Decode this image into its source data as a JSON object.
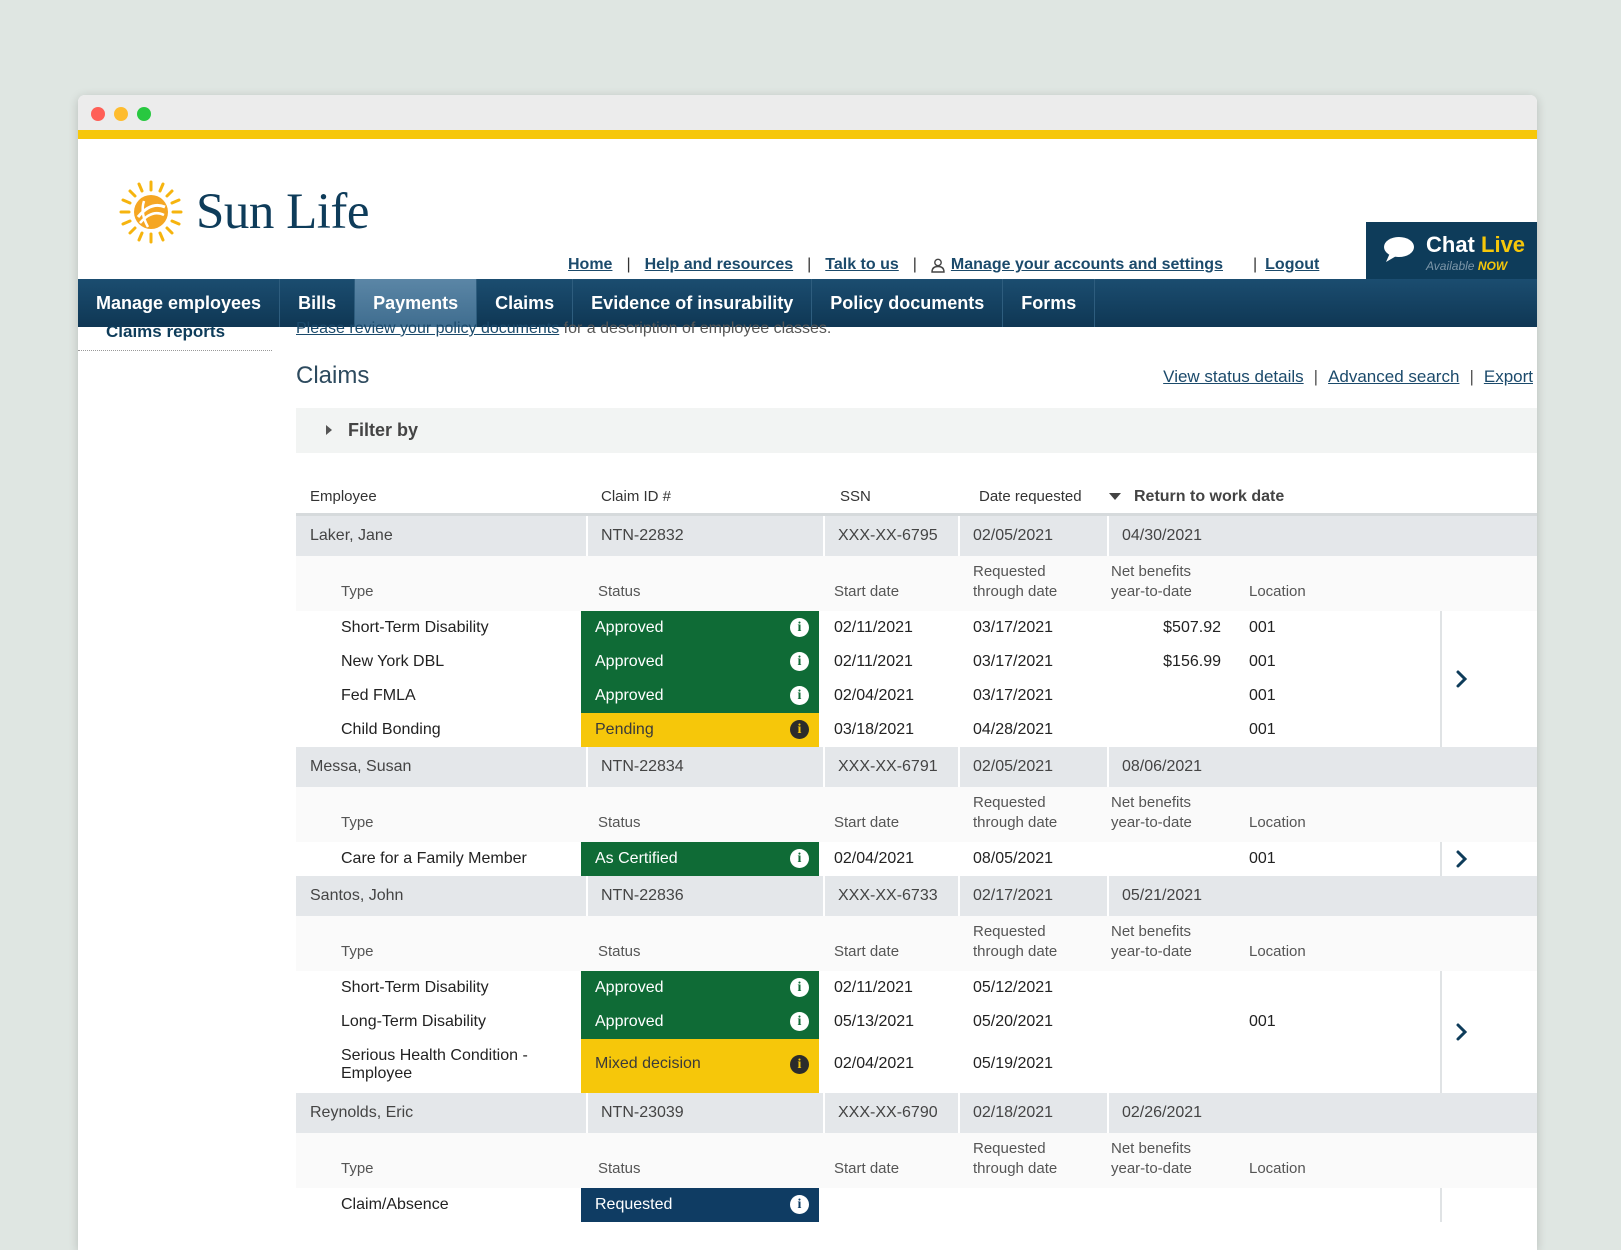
{
  "brand": {
    "name": "Sun Life"
  },
  "toplinks": {
    "home": "Home",
    "help": "Help and resources",
    "talk": "Talk to us",
    "manage": "Manage your accounts and settings",
    "logout": "Logout",
    "sep": "|"
  },
  "chat": {
    "title_a": "Chat",
    "title_b": "Live",
    "sub_a": "Available",
    "sub_b": "NOW"
  },
  "nav": {
    "items": [
      "Manage employees",
      "Bills",
      "Payments",
      "Claims",
      "Evidence of insurability",
      "Policy documents",
      "Forms"
    ],
    "active": "Payments"
  },
  "sidebar": {
    "item": "Claims reports"
  },
  "notice": {
    "link": "Please review your policy documents",
    "rest": " for a description of employee classes."
  },
  "page": {
    "title": "Claims"
  },
  "actions": {
    "status": "View status details",
    "search": "Advanced search",
    "export": "Export",
    "sep": "|"
  },
  "filter": {
    "label": "Filter by"
  },
  "columns": {
    "employee": "Employee",
    "claim": "Claim ID #",
    "ssn": "SSN",
    "date": "Date requested",
    "return": "Return to work date"
  },
  "sub_columns": {
    "type": "Type",
    "status": "Status",
    "start": "Start date",
    "through_a": "Requested",
    "through_b": "through date",
    "net_a": "Net benefits",
    "net_b": "year-to-date",
    "location": "Location"
  },
  "colors": {
    "approved": "#0f6b36",
    "pending": "#f6c70a",
    "requested": "#0f3c63",
    "nav": "#0f3754",
    "accent": "#f6c70a"
  },
  "claims": [
    {
      "employee": "Laker, Jane",
      "claim_id": "NTN-22832",
      "ssn": "XXX-XX-6795",
      "date_requested": "02/05/2021",
      "return_date": "04/30/2021",
      "lines": [
        {
          "type": "Short-Term Disability",
          "status": "Approved",
          "start": "02/11/2021",
          "through": "03/17/2021",
          "net": "$507.92",
          "location": "001"
        },
        {
          "type": "New York DBL",
          "status": "Approved",
          "start": "02/11/2021",
          "through": "03/17/2021",
          "net": "$156.99",
          "location": "001"
        },
        {
          "type": "Fed FMLA",
          "status": "Approved",
          "start": "02/04/2021",
          "through": "03/17/2021",
          "net": "",
          "location": "001"
        },
        {
          "type": "Child Bonding",
          "status": "Pending",
          "start": "03/18/2021",
          "through": "04/28/2021",
          "net": "",
          "location": "001"
        }
      ]
    },
    {
      "employee": "Messa, Susan",
      "claim_id": "NTN-22834",
      "ssn": "XXX-XX-6791",
      "date_requested": "02/05/2021",
      "return_date": "08/06/2021",
      "lines": [
        {
          "type": "Care for a Family Member",
          "status": "As Certified",
          "start": "02/04/2021",
          "through": "08/05/2021",
          "net": "",
          "location": "001"
        }
      ]
    },
    {
      "employee": "Santos, John",
      "claim_id": "NTN-22836",
      "ssn": "XXX-XX-6733",
      "date_requested": "02/17/2021",
      "return_date": "05/21/2021",
      "lines": [
        {
          "type": "Short-Term Disability",
          "status": "Approved",
          "start": "02/11/2021",
          "through": "05/12/2021",
          "net": "",
          "location": ""
        },
        {
          "type": "Long-Term Disability",
          "status": "Approved",
          "start": "05/13/2021",
          "through": "05/20/2021",
          "net": "",
          "location": "001"
        },
        {
          "type": "Serious Health Condition - Employee",
          "status": "Mixed decision",
          "start": "02/04/2021",
          "through": "05/19/2021",
          "net": "",
          "location": ""
        }
      ]
    },
    {
      "employee": "Reynolds, Eric",
      "claim_id": "NTN-23039",
      "ssn": "XXX-XX-6790",
      "date_requested": "02/18/2021",
      "return_date": "02/26/2021",
      "lines": [
        {
          "type": "Claim/Absence",
          "status": "Requested",
          "start": "",
          "through": "",
          "net": "",
          "location": ""
        }
      ]
    }
  ],
  "icons": {
    "info": "info-icon",
    "chevron": "chevron-right-icon",
    "user": "user-icon",
    "chat": "chat-bubble-icon",
    "sun": "sun-logo-icon"
  }
}
